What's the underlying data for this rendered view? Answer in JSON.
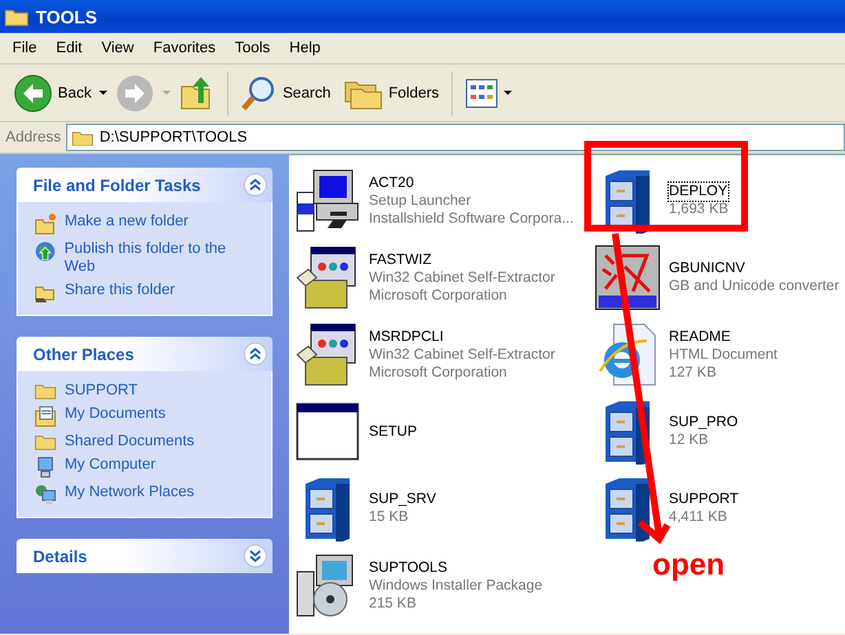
{
  "window": {
    "title": "TOOLS"
  },
  "menu": [
    "File",
    "Edit",
    "View",
    "Favorites",
    "Tools",
    "Help"
  ],
  "toolbar": {
    "back": "Back",
    "forward_disabled": true,
    "search": "Search",
    "folders": "Folders"
  },
  "address": {
    "label": "Address",
    "value": "D:\\SUPPORT\\TOOLS"
  },
  "sidebar": [
    {
      "title": "File and Folder Tasks",
      "expanded": true,
      "items": [
        {
          "label": "Make a new folder",
          "kind": "newfolder"
        },
        {
          "label": "Publish this folder to the Web",
          "kind": "globe"
        },
        {
          "label": "Share this folder",
          "kind": "share"
        }
      ]
    },
    {
      "title": "Other Places",
      "expanded": true,
      "items": [
        {
          "label": "SUPPORT",
          "kind": "folder"
        },
        {
          "label": "My Documents",
          "kind": "documents"
        },
        {
          "label": "Shared Documents",
          "kind": "folder"
        },
        {
          "label": "My Computer",
          "kind": "computer"
        },
        {
          "label": "My Network Places",
          "kind": "network"
        }
      ]
    },
    {
      "title": "Details",
      "expanded": false
    }
  ],
  "files": [
    [
      {
        "name": "ACT20",
        "kind": "launcher",
        "lines": [
          "Setup Launcher",
          "Installshield Software Corpora..."
        ],
        "selected": false
      },
      {
        "name": "FASTWIZ",
        "kind": "cabinet",
        "lines": [
          "Win32 Cabinet Self-Extractor",
          "Microsoft Corporation"
        ],
        "selected": false
      },
      {
        "name": "MSRDPCLI",
        "kind": "cabinet",
        "lines": [
          "Win32 Cabinet Self-Extractor",
          "Microsoft Corporation"
        ],
        "selected": false
      },
      {
        "name": "SETUP",
        "kind": "window",
        "selected": false
      },
      {
        "name": "SUP_SRV",
        "kind": "drawer",
        "lines": [
          "15 KB"
        ],
        "selected": false
      },
      {
        "name": "SUPTOOLS",
        "kind": "installer",
        "lines": [
          "Windows Installer Package",
          "215 KB"
        ],
        "selected": false
      }
    ],
    [
      {
        "name": "DEPLOY",
        "kind": "drawer",
        "lines": [
          "1,693 KB"
        ],
        "selected": true
      },
      {
        "name": "GBUNICNV",
        "kind": "converter",
        "lines": [
          "GB and Unicode converter"
        ],
        "selected": false
      },
      {
        "name": "README",
        "kind": "html",
        "lines": [
          "HTML Document",
          "127 KB"
        ],
        "selected": false
      },
      {
        "name": "SUP_PRO",
        "kind": "drawer",
        "lines": [
          "12 KB"
        ],
        "selected": false
      },
      {
        "name": "SUPPORT",
        "kind": "drawer",
        "lines": [
          "4,411 KB"
        ],
        "selected": false
      }
    ]
  ],
  "annotation": {
    "label": "open"
  }
}
